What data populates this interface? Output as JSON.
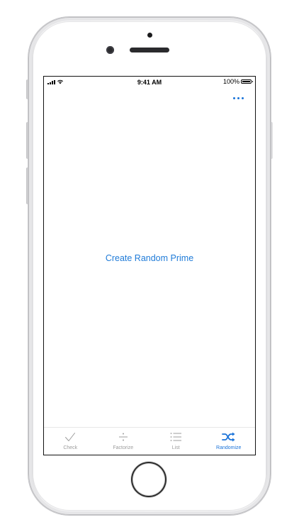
{
  "status_bar": {
    "time": "9:41 AM",
    "battery": "100%"
  },
  "nav": {
    "more_icon": "ellipsis-icon"
  },
  "main": {
    "action_label": "Create Random Prime"
  },
  "tabs": [
    {
      "label": "Check",
      "icon": "checkmark-icon",
      "active": false
    },
    {
      "label": "Factorize",
      "icon": "divide-icon",
      "active": false
    },
    {
      "label": "List",
      "icon": "list-icon",
      "active": false
    },
    {
      "label": "Randomize",
      "icon": "shuffle-icon",
      "active": true
    }
  ],
  "colors": {
    "accent": "#1a73d9",
    "inactive": "#9c9c9c"
  }
}
